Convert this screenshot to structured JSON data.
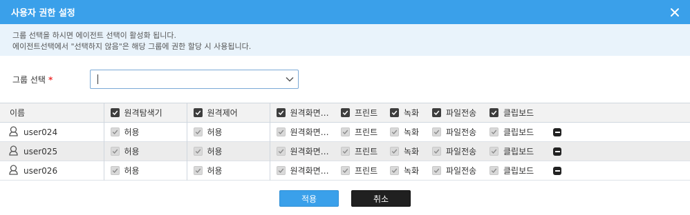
{
  "dialog": {
    "title": "사용자 권한 설정",
    "notice_line1": "그룹 선택을 하시면 에이전트 선택이 활성화 됩니다.",
    "notice_line2": "에이전트선택에서 \"선택하지 않음\"은 해당 그룹에 권한 할당 시 사용됩니다."
  },
  "group": {
    "label": "그룹 선택",
    "required_mark": "*",
    "value": ""
  },
  "table": {
    "columns": [
      "이름",
      "원격탐색기",
      "원격제어",
      "원격화면…",
      "프린트",
      "녹화",
      "파일전송",
      "클립보드"
    ],
    "rows": [
      {
        "name": "user024",
        "perms": [
          "허용",
          "허용",
          "원격화면…",
          "프린트",
          "녹화",
          "파일전송",
          "클립보드"
        ]
      },
      {
        "name": "user025",
        "perms": [
          "허용",
          "허용",
          "원격화면…",
          "프린트",
          "녹화",
          "파일전송",
          "클립보드"
        ]
      },
      {
        "name": "user026",
        "perms": [
          "허용",
          "허용",
          "원격화면…",
          "프린트",
          "녹화",
          "파일전송",
          "클립보드"
        ]
      }
    ]
  },
  "buttons": {
    "apply": "적용",
    "cancel": "취소"
  },
  "colors": {
    "title_bar": "#3aa0ea",
    "notice_bg": "#e9f3fb",
    "apply_button": "#3aa0ea",
    "cancel_button": "#202020",
    "required": "#e33333"
  }
}
